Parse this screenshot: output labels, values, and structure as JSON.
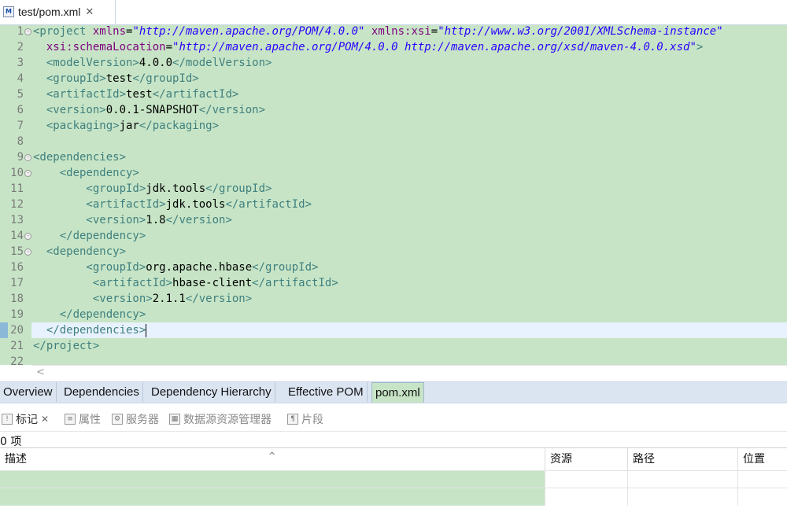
{
  "editor_tab": {
    "title": "test/pom.xml",
    "close": "✕",
    "icon_text": "M"
  },
  "lines": [
    {
      "n": "1"
    },
    {
      "n": "2"
    },
    {
      "n": "3"
    },
    {
      "n": "4"
    },
    {
      "n": "5"
    },
    {
      "n": "6"
    },
    {
      "n": "7"
    },
    {
      "n": "8"
    },
    {
      "n": "9"
    },
    {
      "n": "10"
    },
    {
      "n": "11"
    },
    {
      "n": "12"
    },
    {
      "n": "13"
    },
    {
      "n": "14"
    },
    {
      "n": "15"
    },
    {
      "n": "16"
    },
    {
      "n": "17"
    },
    {
      "n": "18"
    },
    {
      "n": "19"
    },
    {
      "n": "20"
    },
    {
      "n": "21"
    },
    {
      "n": "22"
    }
  ],
  "code": {
    "l1": {
      "p1": "<project ",
      "a1": "xmlns",
      "eq": "=",
      "v1": "\"http://maven.apache.org/POM/4.0.0\"",
      "a2": " xmlns:xsi",
      "v2": "\"http://www.w3.org/2001/XMLSchema-instance\""
    },
    "l2": {
      "a": "  xsi:schemaLocation",
      "eq": "=",
      "v": "\"http://maven.apache.org/POM/4.0.0 http://maven.apache.org/xsd/maven-4.0.0.xsd\"",
      "close": ">"
    },
    "l3": {
      "open": "  <modelVersion>",
      "text": "4.0.0",
      "close": "</modelVersion>"
    },
    "l4": {
      "open": "  <groupId>",
      "text": "test",
      "close": "</groupId>"
    },
    "l5": {
      "open": "  <artifactId>",
      "text": "test",
      "close": "</artifactId>"
    },
    "l6": {
      "open": "  <version>",
      "text": "0.0.1-SNAPSHOT",
      "close": "</version>"
    },
    "l7": {
      "open": "  <packaging>",
      "text": "jar",
      "close": "</packaging>"
    },
    "l9": "<dependencies>",
    "l10": "    <dependency>",
    "l11": {
      "open": "        <groupId>",
      "text": "jdk.tools",
      "close": "</groupId>"
    },
    "l12": {
      "open": "        <artifactId>",
      "text": "jdk.tools",
      "close": "</artifactId>"
    },
    "l13": {
      "open": "        <version>",
      "text": "1.8",
      "close": "</version>"
    },
    "l14": "    </dependency>",
    "l15": "  <dependency>",
    "l16": {
      "open": "        <groupId>",
      "text": "org.apache.hbase",
      "close": "</groupId>"
    },
    "l17": {
      "open": "         <artifactId>",
      "text": "hbase-client",
      "close": "</artifactId>"
    },
    "l18": {
      "open": "         <version>",
      "text": "2.1.1",
      "close": "</version>"
    },
    "l19": "    </dependency>",
    "l20": "  </dependencies>",
    "l21": "</project>"
  },
  "pom_tabs": [
    "Overview",
    "Dependencies",
    "Dependency Hierarchy",
    "Effective POM",
    "pom.xml"
  ],
  "views": {
    "markers": "标记",
    "properties": "属性",
    "servers": "服务器",
    "datasource": "数据源资源管理器",
    "snippets": "片段",
    "close": "✕"
  },
  "item_count": "0 项",
  "table": {
    "headers": [
      "描述",
      "资源",
      "路径",
      "位置"
    ],
    "sort_indicator": "^"
  },
  "colors": {
    "editor_bg": "#c7e5c6",
    "tag": "#3f7f7f",
    "attr": "#7f007f",
    "value": "#2a00ff",
    "current_line": "#e8f2fe"
  }
}
